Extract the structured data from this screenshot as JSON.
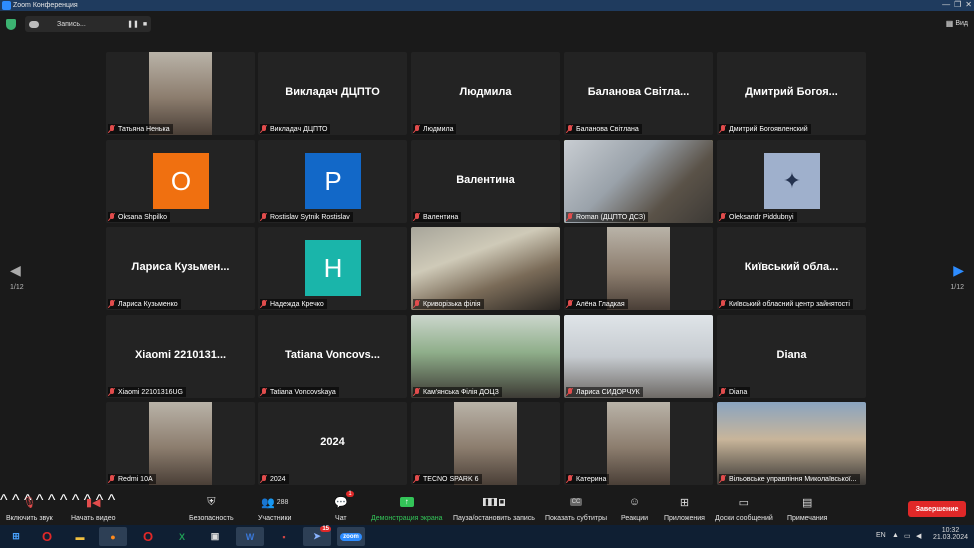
{
  "window": {
    "title": "Zoom Конференция",
    "controls": [
      "—",
      "❐",
      "✕"
    ]
  },
  "topbar": {
    "record_label": "Запись...",
    "pause_glyph": "❚❚",
    "stop_glyph": "■",
    "view_label": "Вид",
    "view_glyph": "▦"
  },
  "tiles": [
    {
      "name": "Татьяна Ненька",
      "display": "",
      "kind": "photo"
    },
    {
      "name": "Викладач ДЦПТО",
      "display": "Викладач ДЦПТО",
      "kind": "text"
    },
    {
      "name": "Людмила",
      "display": "Людмила",
      "kind": "text"
    },
    {
      "name": "Баланова Світлана",
      "display": "Баланова Світла...",
      "kind": "text"
    },
    {
      "name": "Дмитрий Богоявленский",
      "display": "Дмитрий Богоя...",
      "kind": "text"
    },
    {
      "name": "Oksana Shpilko",
      "display": "O",
      "kind": "avatar",
      "color": "#f07010"
    },
    {
      "name": "Rostislav Sytnik Rostislav",
      "display": "P",
      "kind": "avatar",
      "color": "#1268c8"
    },
    {
      "name": "Валентина",
      "display": "Валентина",
      "kind": "text"
    },
    {
      "name": "Roman (ДЦПТО ДСЗ)",
      "display": "",
      "kind": "video",
      "active": true
    },
    {
      "name": "Oleksandr Piddubnyi",
      "display": "",
      "kind": "logo"
    },
    {
      "name": "Лариса Кузьменко",
      "display": "Лариса Кузьмен...",
      "kind": "text"
    },
    {
      "name": "Надежда Кречко",
      "display": "H",
      "kind": "avatar",
      "color": "#1ab5aa"
    },
    {
      "name": "Криворізька філія",
      "display": "",
      "kind": "video"
    },
    {
      "name": "Алёна Гладкая",
      "display": "",
      "kind": "photo"
    },
    {
      "name": "Київський обласний центр зайнятості",
      "display": "Київський обла...",
      "kind": "text"
    },
    {
      "name": "Xiaomi 22101316UG",
      "display": "Xiaomi 2210131...",
      "kind": "text"
    },
    {
      "name": "Tatiana Voncovskaya",
      "display": "Tatiana Voncovs...",
      "kind": "text"
    },
    {
      "name": "Кам'янська Філія ДОЦЗ",
      "display": "",
      "kind": "video"
    },
    {
      "name": "Лариса СИДОРЧУК",
      "display": "",
      "kind": "video"
    },
    {
      "name": "Diana",
      "display": "Diana",
      "kind": "text"
    },
    {
      "name": "Redmi 10A",
      "display": "",
      "kind": "photo"
    },
    {
      "name": "2024",
      "display": "2024",
      "kind": "text"
    },
    {
      "name": "TECNO SPARK 6",
      "display": "",
      "kind": "photo"
    },
    {
      "name": "Катерина",
      "display": "",
      "kind": "photo"
    },
    {
      "name": "Вільовське управління Миколаївської...",
      "display": "",
      "kind": "video"
    }
  ],
  "pagination": {
    "left": "1/12",
    "right": "1/12"
  },
  "toolbar": {
    "unmute": "Включить звук",
    "start_video": "Начать видео",
    "security": "Безопасность",
    "participants": "Участники",
    "participants_count": "288",
    "chat": "Чат",
    "chat_badge": "1",
    "share": "Демонстрация экрана",
    "pause_record": "Пауза/остановить запись",
    "captions": "Показать субтитры",
    "captions_icon": "CC",
    "reactions": "Реакции",
    "apps": "Приложения",
    "whiteboards": "Доски сообщений",
    "notes": "Примечания",
    "end": "Завершение"
  },
  "taskbar": {
    "lang": "EN",
    "time": "10:32",
    "date": "21.03.2024",
    "zoom_label": "zoom",
    "opera_label": "O",
    "excel_label": "X",
    "word_label": "W",
    "telegram_badge": "15"
  },
  "colors": {
    "active_border": "#e6e25a",
    "end_red": "#e02828",
    "share_green": "#33c458",
    "accent_blue": "#2d8cff"
  }
}
